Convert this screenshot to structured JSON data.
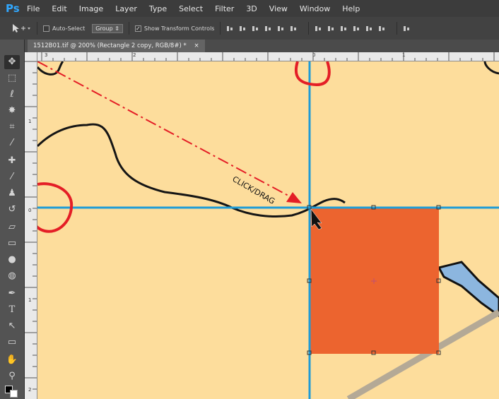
{
  "app": {
    "logo": "Ps"
  },
  "menu": [
    "File",
    "Edit",
    "Image",
    "Layer",
    "Type",
    "Select",
    "Filter",
    "3D",
    "View",
    "Window",
    "Help"
  ],
  "options": {
    "auto_select_label": "Auto-Select",
    "group_value": "Group",
    "transform_label": "Show Transform Controls",
    "checkmark": "✓"
  },
  "document": {
    "tab_title": "1512B01.tif @ 200% (Rectangle 2 copy, RGB/8#) *",
    "tab_close": "×"
  },
  "rulers": {
    "horizontal": [
      "3",
      "2",
      "0",
      "1"
    ],
    "vertical": [
      "1",
      "0",
      "1",
      "2"
    ]
  },
  "annotation": {
    "text": "CLICK/DRAG"
  },
  "colors": {
    "canvas": "#fddd9c",
    "guide": "#1e9bd7",
    "rectangle": "#ec642f",
    "annotation_red": "#e41e26",
    "water": "#8cb6df",
    "road": "#b4a996"
  },
  "icons": [
    "move-tool-icon",
    "marquee-tool-icon",
    "lasso-tool-icon",
    "magic-wand-icon",
    "crop-tool-icon",
    "eyedropper-icon",
    "healing-brush-icon",
    "brush-tool-icon",
    "clone-stamp-icon",
    "history-brush-icon",
    "eraser-icon",
    "gradient-icon",
    "blur-tool-icon",
    "dodge-tool-icon",
    "pen-tool-icon",
    "type-tool-icon",
    "path-selection-icon",
    "rectangle-tool-icon",
    "hand-tool-icon",
    "zoom-tool-icon"
  ]
}
